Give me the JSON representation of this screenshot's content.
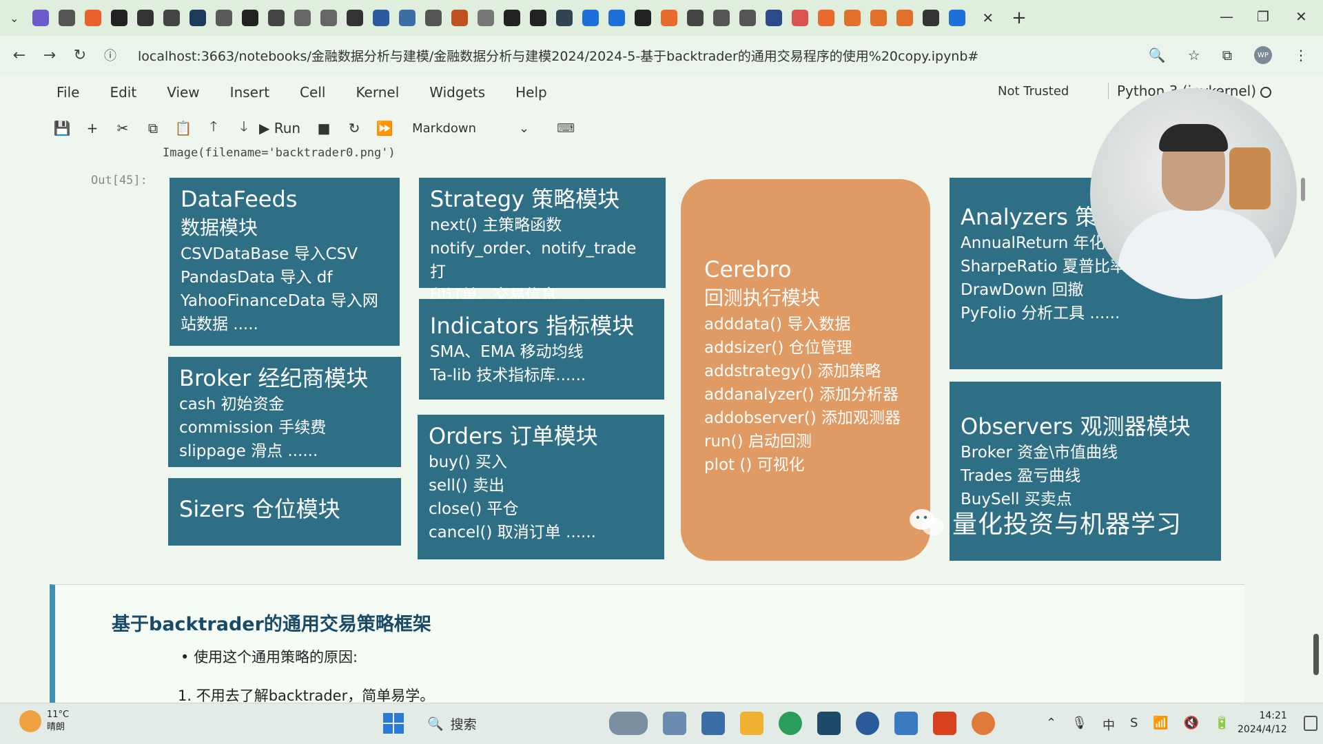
{
  "browser": {
    "tab_icons": [
      {
        "name": "tab-app-icon",
        "color": "#6a5acd"
      },
      {
        "name": "chat-icon",
        "color": "#555555"
      },
      {
        "name": "tab-orange-icon",
        "color": "#e8622c"
      },
      {
        "name": "github-icon",
        "color": "#222222"
      },
      {
        "name": "tab-dark-icon",
        "color": "#333333"
      },
      {
        "name": "tab-video-icon",
        "color": "#444444"
      },
      {
        "name": "tab-app2-icon",
        "color": "#1b3a5c"
      },
      {
        "name": "tab-51-icon",
        "color": "#5a5a5a"
      },
      {
        "name": "github-icon",
        "color": "#222222"
      },
      {
        "name": "tab-video2-icon",
        "color": "#444444"
      },
      {
        "name": "cloud-icon",
        "color": "#666666"
      },
      {
        "name": "cloud-icon",
        "color": "#666666"
      },
      {
        "name": "tab-run-icon",
        "color": "#333333"
      },
      {
        "name": "tab-book-icon",
        "color": "#2c5aa0"
      },
      {
        "name": "tab-globe-icon",
        "color": "#3a6ea5"
      },
      {
        "name": "globe-icon",
        "color": "#555555"
      },
      {
        "name": "tab-pdf-icon",
        "color": "#c05020"
      },
      {
        "name": "tab-shield-icon",
        "color": "#777777"
      },
      {
        "name": "github-icon",
        "color": "#222222"
      },
      {
        "name": "github-icon",
        "color": "#222222"
      },
      {
        "name": "tab-circle-icon",
        "color": "#334455"
      },
      {
        "name": "zhihu-icon",
        "color": "#1e6fd9"
      },
      {
        "name": "zhihu-icon",
        "color": "#1e6fd9"
      },
      {
        "name": "github-icon",
        "color": "#222222"
      },
      {
        "name": "tab-c-icon",
        "color": "#e86a2c"
      },
      {
        "name": "tab-a-icon",
        "color": "#444444"
      },
      {
        "name": "globe-icon",
        "color": "#555555"
      },
      {
        "name": "tab-m-icon",
        "color": "#555555"
      },
      {
        "name": "tab-k-icon",
        "color": "#2a4a8a"
      },
      {
        "name": "tab-jian-icon",
        "color": "#d9534f"
      },
      {
        "name": "tab-c2-icon",
        "color": "#e86a2c"
      },
      {
        "name": "tab-pen-icon",
        "color": "#e0702a"
      },
      {
        "name": "tab-pen-icon",
        "color": "#e0702a"
      },
      {
        "name": "tab-pen-icon",
        "color": "#e0702a"
      },
      {
        "name": "paw-icon",
        "color": "#333333"
      },
      {
        "name": "zhihu-icon",
        "color": "#1e6fd9"
      }
    ],
    "url": "localhost:3663/notebooks/金融数据分析与建模/金融数据分析与建模2024/2024-5-基于backtrader的通用交易程序的使用%20copy.ipynb#",
    "profile_initials": "WP"
  },
  "jupyter": {
    "menu": [
      "File",
      "Edit",
      "View",
      "Insert",
      "Cell",
      "Kernel",
      "Widgets",
      "Help"
    ],
    "trust": "Not Trusted",
    "kernel": "Python 3 (ipykernel)",
    "toolbar": {
      "run_label": "Run",
      "cell_type": "Markdown"
    }
  },
  "notebook": {
    "code_line": "Image(filename='backtrader0.png')",
    "out_label": "Out[45]:",
    "diagram": {
      "datafeeds": {
        "title": "DataFeeds",
        "subtitle": "数据模块",
        "lines": [
          "CSVDataBase 导入CSV",
          "PandasData 导入 df",
          "YahooFinanceData 导入网",
          "站数据 ....."
        ]
      },
      "broker": {
        "title": "Broker  经纪商模块",
        "lines": [
          "cash 初始资金",
          "commission 手续费",
          "slippage 滑点 ......"
        ]
      },
      "sizers": {
        "title": "Sizers  仓位模块"
      },
      "strategy": {
        "title": "Strategy  策略模块",
        "lines": [
          "next() 主策略函数",
          "notify_order、notify_trade 打",
          "印订单、交易信息 ....."
        ]
      },
      "indicators": {
        "title": "Indicators  指标模块",
        "lines": [
          "SMA、EMA 移动均线",
          "Ta-lib 技术指标库......"
        ]
      },
      "orders": {
        "title": "Orders  订单模块",
        "lines": [
          "buy() 买入",
          "sell() 卖出",
          "close() 平仓",
          "cancel() 取消订单 ......"
        ]
      },
      "cerebro": {
        "title": "Cerebro",
        "subtitle": "回测执行模块",
        "lines": [
          "adddata() 导入数据",
          "addsizer() 仓位管理",
          "addstrategy() 添加策略",
          "addanalyzer() 添加分析器",
          "addobserver() 添加观测器",
          "run() 启动回测",
          "plot () 可视化"
        ]
      },
      "analyzers": {
        "title": "Analyzers  策",
        "lines": [
          "AnnualReturn 年化",
          "SharpeRatio 夏普比率",
          "DrawDown 回撤",
          "PyFolio 分析工具 ......"
        ]
      },
      "observers": {
        "title": "Observers  观测器模块",
        "lines": [
          "Broker 资金\\市值曲线",
          "Trades 盈亏曲线",
          "BuySell 买卖点"
        ]
      },
      "watermark": "量化投资与机器学习",
      "colors": {
        "box": "#2f6f86",
        "cerebro": "#e09a63"
      }
    },
    "markdown": {
      "heading": "基于backtrader的通用交易策略框架",
      "bullet": "使用这个通用策略的原因:",
      "numbered": "1. 不用去了解backtrader，简单易学。"
    }
  },
  "taskbar": {
    "weather_temp": "11°C",
    "weather_desc": "晴朗",
    "search_placeholder": "搜索",
    "time": "14:21",
    "date": "2024/4/12"
  }
}
